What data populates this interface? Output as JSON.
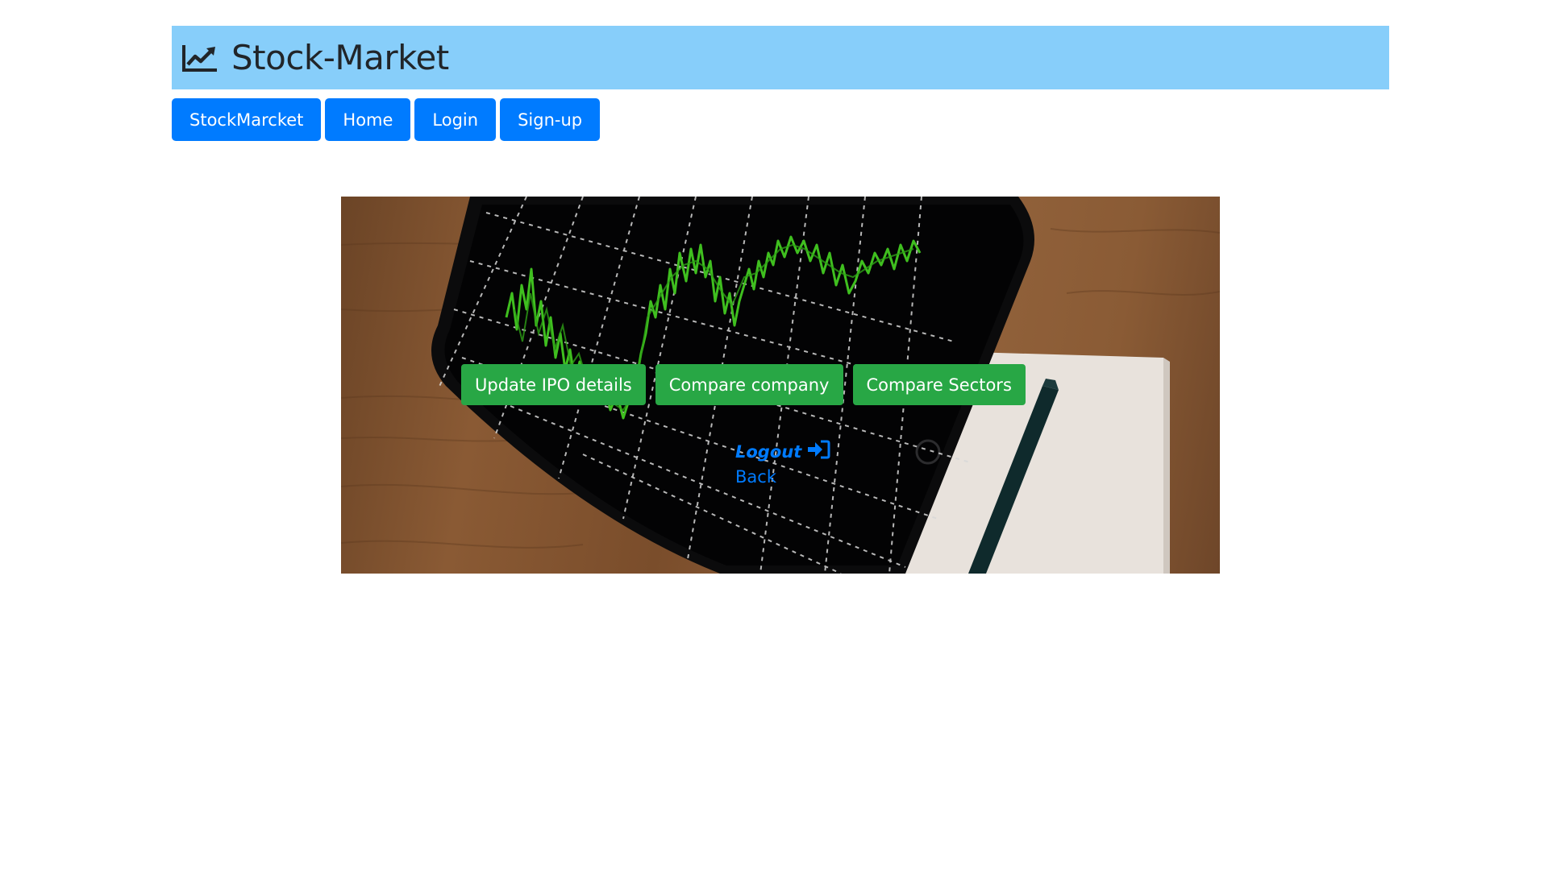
{
  "header": {
    "title": "Stock-Market",
    "icon": "chart-line-icon"
  },
  "nav": {
    "items": [
      {
        "label": "StockMarcket"
      },
      {
        "label": "Home"
      },
      {
        "label": "Login"
      },
      {
        "label": "Sign-up"
      }
    ]
  },
  "hero": {
    "image": "stock-chart-tablet-photo",
    "actions": [
      {
        "label": "Update IPO details"
      },
      {
        "label": "Compare company"
      },
      {
        "label": "Compare Sectors"
      }
    ],
    "logout": {
      "label": "Logout",
      "icon": "sign-in-icon"
    },
    "back": {
      "label": "Back"
    }
  },
  "colors": {
    "header_bg": "#87cefa",
    "primary": "#007bff",
    "success": "#28a745",
    "text_dark": "#212529"
  }
}
